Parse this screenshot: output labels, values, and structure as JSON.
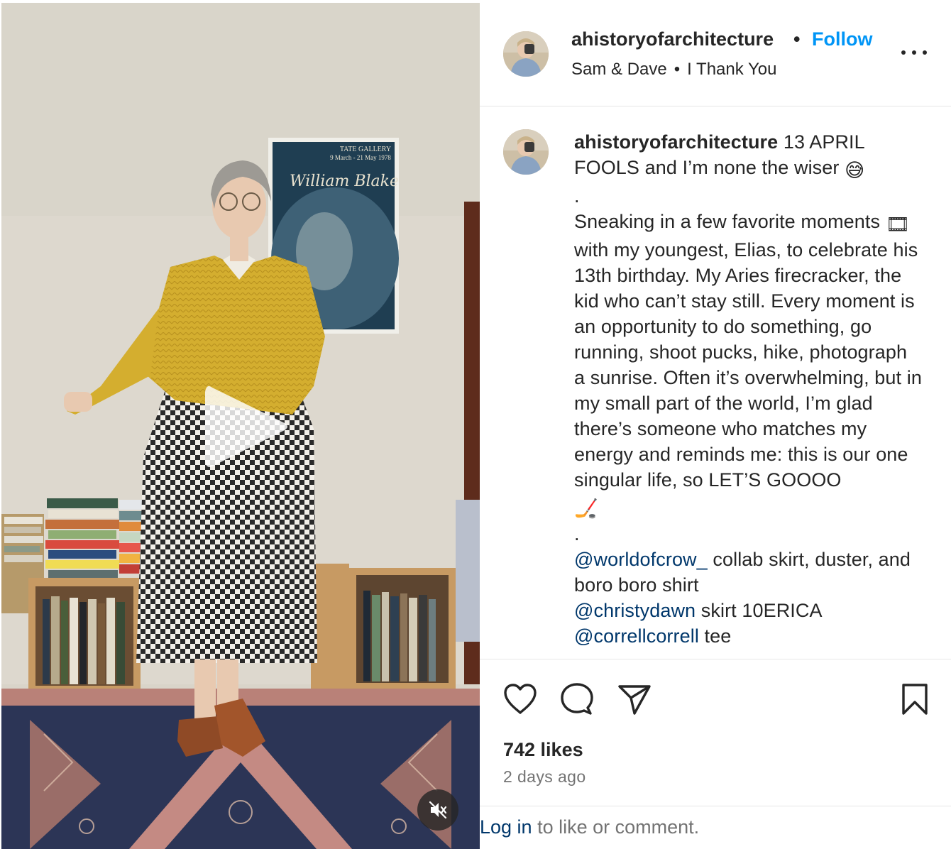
{
  "post": {
    "username": "ahistoryofarchitecture",
    "header_separator": "•",
    "follow_label": "Follow",
    "audio": {
      "artist": "Sam & Dave",
      "separator": "•",
      "track": "I Thank You"
    }
  },
  "caption": {
    "username": "ahistoryofarchitecture",
    "intro": " 13 APRIL FOOLS and I’m none the wiser ",
    "dot1": ".",
    "body_part1": "Sneaking in a few favorite moments ",
    "body_part2": " with my youngest, Elias, to celebrate his 13th birthday. My Aries firecracker, the kid who can’t stay still. Every moment is an opportunity to do something, go running, shoot pucks, hike, photograph a sunrise. Often it’s overwhelming, but in my small part of the world, I’m glad there’s someone who matches my energy and reminds me: this is our one singular life, so LET’S GOOOO ",
    "dot2": ".",
    "mention1": "@worldofcrow_",
    "credit1": " collab skirt, duster, and boro boro shirt",
    "mention2": "@christydawn",
    "credit2": " skirt 10ERICA",
    "mention3": "@correllcorrell",
    "credit3": " tee"
  },
  "emojis": {
    "sweat_smile": "😅",
    "film": "🎞",
    "hockey": "🏒"
  },
  "engagement": {
    "likes": "742 likes",
    "time": "2 days ago"
  },
  "login": {
    "link": "Log in",
    "text": " to like or comment."
  },
  "media": {
    "poster_gallery": "TATE GALLERY",
    "poster_dates": "9 March - 21 May 1978",
    "poster_title": "William Blake"
  },
  "icons": {
    "like": "heart-outline-icon",
    "comment": "speech-bubble-icon",
    "share": "paper-plane-icon",
    "save": "bookmark-outline-icon",
    "more": "ellipsis-icon",
    "play": "play-icon",
    "mute": "speaker-muted-icon"
  },
  "colors": {
    "follow": "#0095f6",
    "mention": "#00376b",
    "secondary_text": "#737373"
  }
}
